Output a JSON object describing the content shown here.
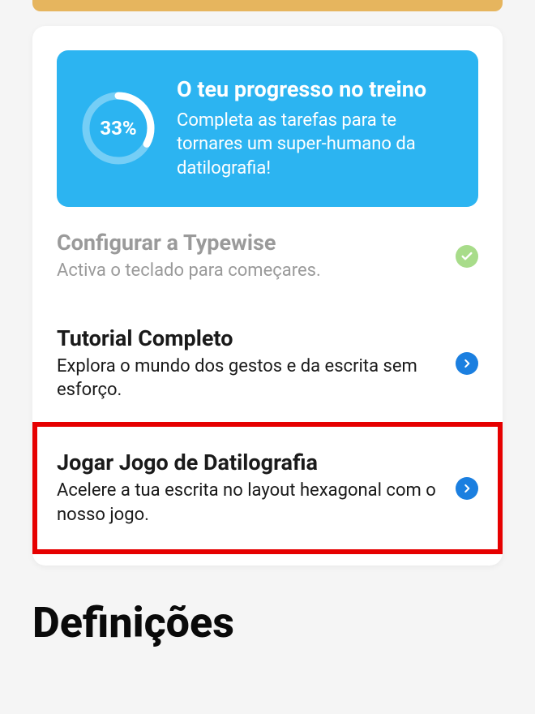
{
  "progress": {
    "percent_label": "33%",
    "percent_value": 33,
    "title": "O teu progresso no treino",
    "description": "Completa as tarefas para te tornares um super-humano da datilografia!"
  },
  "tasks": {
    "configure": {
      "title": "Configurar a Typewise",
      "description": "Activa o teclado para começares."
    },
    "tutorial": {
      "title": "Tutorial Completo",
      "description": "Explora o mundo dos gestos e da escrita sem esforço."
    },
    "game": {
      "title": "Jogar Jogo de Datilografia",
      "description": "Acelere a tua escrita no layout hexagonal com o nosso jogo."
    }
  },
  "section_heading": "Definições"
}
